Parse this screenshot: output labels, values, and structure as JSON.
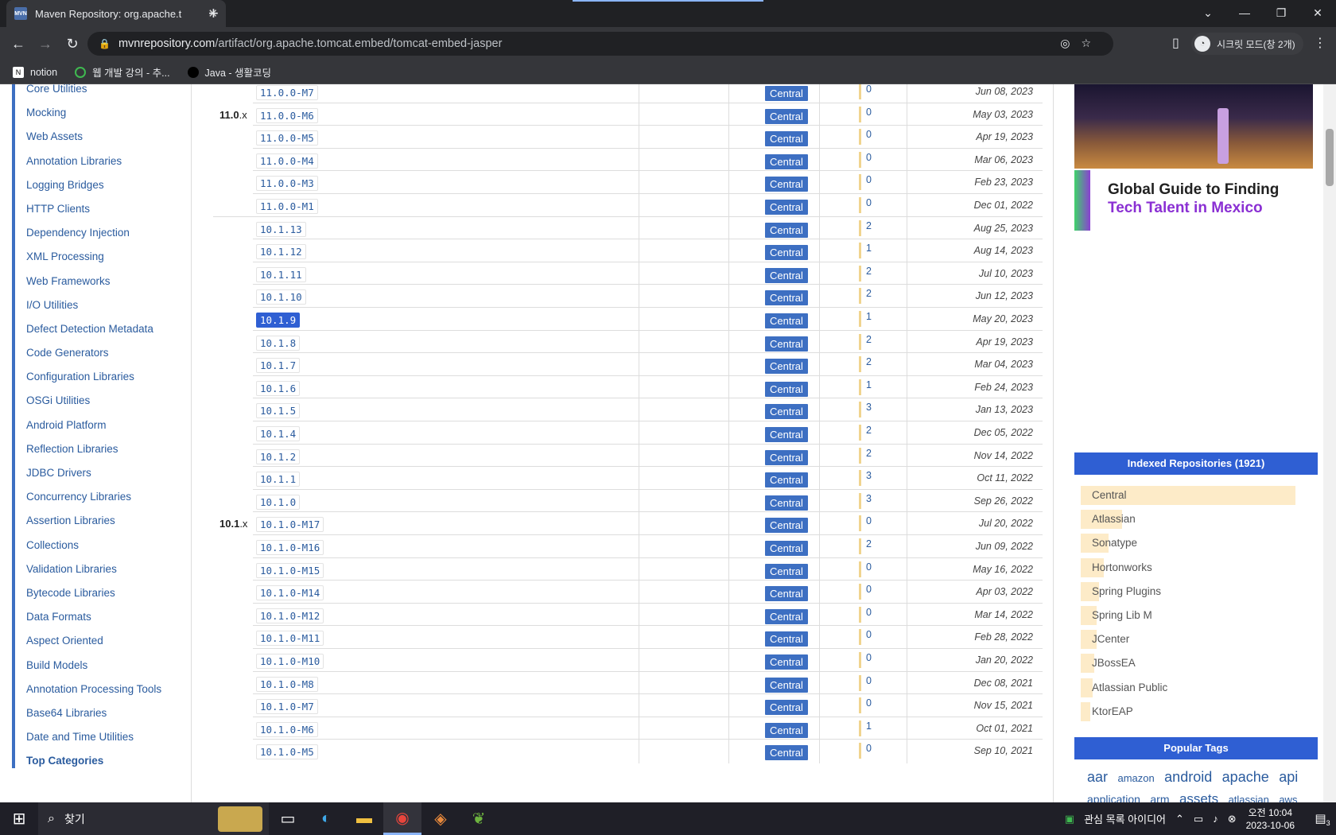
{
  "browser": {
    "tab_title": "Maven Repository: org.apache.t",
    "favicon_text": "MVN",
    "new_tab": "+",
    "url_host": "mvnrepository.com",
    "url_path": "/artifact/org.apache.tomcat.embed/tomcat-embed-jasper",
    "profile_label": "시크릿 모드(창 2개)",
    "bookmarks": [
      "notion",
      "웹 개발 강의 - 추...",
      "Java - 생활코딩"
    ]
  },
  "sidebar": {
    "items": [
      "Core Utilities",
      "Mocking",
      "Web Assets",
      "Annotation Libraries",
      "Logging Bridges",
      "HTTP Clients",
      "Dependency Injection",
      "XML Processing",
      "Web Frameworks",
      "I/O Utilities",
      "Defect Detection Metadata",
      "Code Generators",
      "Configuration Libraries",
      "OSGi Utilities",
      "Android Platform",
      "Reflection Libraries",
      "JDBC Drivers",
      "Concurrency Libraries",
      "Assertion Libraries",
      "Collections",
      "Validation Libraries",
      "Bytecode Libraries",
      "Data Formats",
      "Aspect Oriented",
      "Build Models",
      "Annotation Processing Tools",
      "Base64 Libraries",
      "Date and Time Utilities"
    ],
    "footer": "Top Categories"
  },
  "versions": {
    "groups": [
      {
        "label": "11.0",
        "suffix": ".x"
      },
      {
        "label": "10.1",
        "suffix": ".x"
      }
    ],
    "rows": [
      {
        "version": "11.0.0-M7",
        "repo": "Central",
        "usages": "0",
        "date": "Jun 08, 2023"
      },
      {
        "version": "11.0.0-M6",
        "repo": "Central",
        "usages": "0",
        "date": "May 03, 2023"
      },
      {
        "version": "11.0.0-M5",
        "repo": "Central",
        "usages": "0",
        "date": "Apr 19, 2023"
      },
      {
        "version": "11.0.0-M4",
        "repo": "Central",
        "usages": "0",
        "date": "Mar 06, 2023"
      },
      {
        "version": "11.0.0-M3",
        "repo": "Central",
        "usages": "0",
        "date": "Feb 23, 2023"
      },
      {
        "version": "11.0.0-M1",
        "repo": "Central",
        "usages": "0",
        "date": "Dec 01, 2022"
      },
      {
        "version": "10.1.13",
        "repo": "Central",
        "usages": "2",
        "date": "Aug 25, 2023"
      },
      {
        "version": "10.1.12",
        "repo": "Central",
        "usages": "1",
        "date": "Aug 14, 2023"
      },
      {
        "version": "10.1.11",
        "repo": "Central",
        "usages": "2",
        "date": "Jul 10, 2023"
      },
      {
        "version": "10.1.10",
        "repo": "Central",
        "usages": "2",
        "date": "Jun 12, 2023"
      },
      {
        "version": "10.1.9",
        "repo": "Central",
        "usages": "1",
        "date": "May 20, 2023"
      },
      {
        "version": "10.1.8",
        "repo": "Central",
        "usages": "2",
        "date": "Apr 19, 2023"
      },
      {
        "version": "10.1.7",
        "repo": "Central",
        "usages": "2",
        "date": "Mar 04, 2023"
      },
      {
        "version": "10.1.6",
        "repo": "Central",
        "usages": "1",
        "date": "Feb 24, 2023"
      },
      {
        "version": "10.1.5",
        "repo": "Central",
        "usages": "3",
        "date": "Jan 13, 2023"
      },
      {
        "version": "10.1.4",
        "repo": "Central",
        "usages": "2",
        "date": "Dec 05, 2022"
      },
      {
        "version": "10.1.2",
        "repo": "Central",
        "usages": "2",
        "date": "Nov 14, 2022"
      },
      {
        "version": "10.1.1",
        "repo": "Central",
        "usages": "3",
        "date": "Oct 11, 2022"
      },
      {
        "version": "10.1.0",
        "repo": "Central",
        "usages": "3",
        "date": "Sep 26, 2022"
      },
      {
        "version": "10.1.0-M17",
        "repo": "Central",
        "usages": "0",
        "date": "Jul 20, 2022"
      },
      {
        "version": "10.1.0-M16",
        "repo": "Central",
        "usages": "2",
        "date": "Jun 09, 2022"
      },
      {
        "version": "10.1.0-M15",
        "repo": "Central",
        "usages": "0",
        "date": "May 16, 2022"
      },
      {
        "version": "10.1.0-M14",
        "repo": "Central",
        "usages": "0",
        "date": "Apr 03, 2022"
      },
      {
        "version": "10.1.0-M12",
        "repo": "Central",
        "usages": "0",
        "date": "Mar 14, 2022"
      },
      {
        "version": "10.1.0-M11",
        "repo": "Central",
        "usages": "0",
        "date": "Feb 28, 2022"
      },
      {
        "version": "10.1.0-M10",
        "repo": "Central",
        "usages": "0",
        "date": "Jan 20, 2022"
      },
      {
        "version": "10.1.0-M8",
        "repo": "Central",
        "usages": "0",
        "date": "Dec 08, 2021"
      },
      {
        "version": "10.1.0-M7",
        "repo": "Central",
        "usages": "0",
        "date": "Nov 15, 2021"
      },
      {
        "version": "10.1.0-M6",
        "repo": "Central",
        "usages": "1",
        "date": "Oct 01, 2021"
      },
      {
        "version": "10.1.0-M5",
        "repo": "Central",
        "usages": "0",
        "date": "Sep 10, 2021"
      }
    ],
    "selected_version": "10.1.9"
  },
  "ad": {
    "line1": "Global Guide to Finding",
    "line2": "Tech Talent in Mexico"
  },
  "indexed_repos": {
    "title": "Indexed Repositories (1921)",
    "items": [
      {
        "name": "Central",
        "share": 0.93
      },
      {
        "name": "Atlassian",
        "share": 0.18
      },
      {
        "name": "Sonatype",
        "share": 0.12
      },
      {
        "name": "Hortonworks",
        "share": 0.1
      },
      {
        "name": "Spring Plugins",
        "share": 0.08
      },
      {
        "name": "Spring Lib M",
        "share": 0.07
      },
      {
        "name": "JCenter",
        "share": 0.07
      },
      {
        "name": "JBossEA",
        "share": 0.06
      },
      {
        "name": "Atlassian Public",
        "share": 0.05
      },
      {
        "name": "KtorEAP",
        "share": 0.04
      }
    ]
  },
  "popular_tags": {
    "title": "Popular Tags",
    "tags": [
      "aar",
      "amazon",
      "android",
      "apache",
      "api",
      "application",
      "arm",
      "assets",
      "atlassian",
      "aws"
    ]
  },
  "taskbar": {
    "search_label": "찾기",
    "tray_text": "관심 목록 아이디어",
    "time": "오전 10:04",
    "date": "2023-10-06",
    "notifications": "3"
  },
  "colors": {
    "accent": "#2f5fd3",
    "repo_badge": "#3d6fc2",
    "link": "#2a5b9e"
  }
}
